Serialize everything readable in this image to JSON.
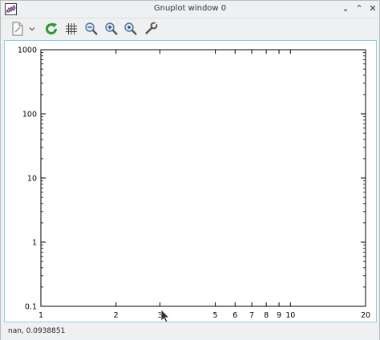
{
  "window": {
    "title": "Gnuplot window 0"
  },
  "icons": {
    "app": "gnuplot-app-icon",
    "export": "export-document-icon",
    "export_menu": "chevron-down-icon",
    "replot": "replot-refresh-icon",
    "grid": "grid-icon",
    "zoom_prev": "zoom-previous-icon",
    "zoom_next": "zoom-next-icon",
    "unzoom": "unzoom-icon",
    "settings": "settings-wrench-icon"
  },
  "window_buttons": {
    "minimize": "⌄",
    "maximize": "⌃",
    "close": "✕"
  },
  "chart_data": {
    "type": "scatter",
    "x_scale": "log",
    "y_scale": "log",
    "xlim": [
      1,
      20
    ],
    "ylim": [
      0.1,
      1000
    ],
    "x_ticks": [
      "1",
      "2",
      "3",
      "5",
      "6",
      "7",
      "8",
      "9",
      "10",
      "20"
    ],
    "x_tick_values": [
      1,
      2,
      3,
      5,
      6,
      7,
      8,
      9,
      10,
      20
    ],
    "y_ticks": [
      "0.1",
      "1",
      "10",
      "100",
      "1000"
    ],
    "y_tick_values": [
      0.1,
      1,
      10,
      100,
      1000
    ],
    "series": [],
    "grid": false
  },
  "status": {
    "text": "nan,  0.0938851"
  },
  "colors": {
    "accent_border": "#8ed2e0",
    "replot_green": "#2a9a2a"
  }
}
